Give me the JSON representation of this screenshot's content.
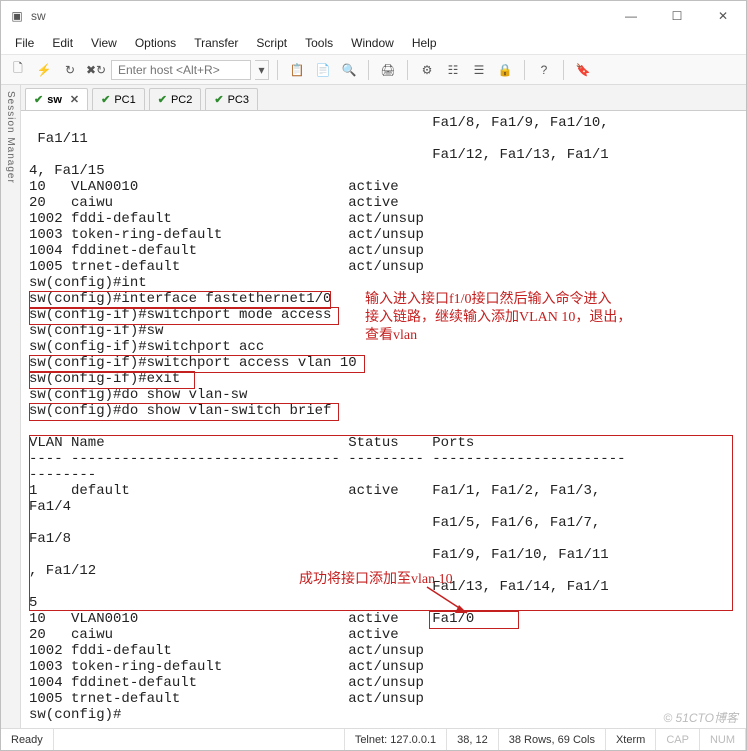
{
  "window": {
    "title": "sw"
  },
  "winbtn": {
    "min": "—",
    "max": "☐",
    "close": "✕"
  },
  "menu": {
    "file": "File",
    "edit": "Edit",
    "view": "View",
    "options": "Options",
    "transfer": "Transfer",
    "script": "Script",
    "tools": "Tools",
    "window": "Window",
    "help": "Help"
  },
  "toolbar": {
    "host_placeholder": "Enter host <Alt+R>"
  },
  "icons": {
    "app": "▣",
    "newdoc": "🗋",
    "bolt": "⚡",
    "reconnect": "↻",
    "disconnect": "✖↻",
    "paste": "📋",
    "copy": "📄",
    "find": "🔍",
    "print": "🖨",
    "cfg": "⚙",
    "opts": "☷",
    "props": "☰",
    "lock": "🔒",
    "help": "?",
    "bookmarks": "🔖"
  },
  "sidebar": {
    "label": "Session Manager"
  },
  "tabs": [
    {
      "label": "sw",
      "active": true,
      "closable": true
    },
    {
      "label": "PC1",
      "active": false,
      "closable": false
    },
    {
      "label": "PC2",
      "active": false,
      "closable": false
    },
    {
      "label": "PC3",
      "active": false,
      "closable": false
    }
  ],
  "terminal": {
    "text": "                                                Fa1/8, Fa1/9, Fa1/10,\n Fa1/11\n                                                Fa1/12, Fa1/13, Fa1/1\n4, Fa1/15\n10   VLAN0010                         active\n20   caiwu                            active\n1002 fddi-default                     act/unsup\n1003 token-ring-default               act/unsup\n1004 fddinet-default                  act/unsup\n1005 trnet-default                    act/unsup\nsw(config)#int\nsw(config)#interface fastethernet1/0\nsw(config-if)#switchport mode access\nsw(config-if)#sw\nsw(config-if)#switchport acc\nsw(config-if)#switchport access vlan 10\nsw(config-if)#exit\nsw(config)#do show vlan-sw\nsw(config)#do show vlan-switch brief\n\nVLAN Name                             Status    Ports\n---- -------------------------------- --------- -----------------------\n--------\n1    default                          active    Fa1/1, Fa1/2, Fa1/3,\nFa1/4\n                                                Fa1/5, Fa1/6, Fa1/7,\nFa1/8\n                                                Fa1/9, Fa1/10, Fa1/11\n, Fa1/12\n                                                Fa1/13, Fa1/14, Fa1/1\n5\n10   VLAN0010                         active    Fa1/0\n20   caiwu                            active\n1002 fddi-default                     act/unsup\n1003 token-ring-default               act/unsup\n1004 fddinet-default                  act/unsup\n1005 trnet-default                    act/unsup\nsw(config)#"
  },
  "annotations": {
    "note1": "输入进入接口f1/0接口然后输入命令进入\n接入链路，继续输入添加VLAN 10，退出，\n查看vlan",
    "note2": "成功将接口添加至vlan 10"
  },
  "status": {
    "ready": "Ready",
    "conn": "Telnet: 127.0.0.1",
    "pos": "38,  12",
    "size": "38 Rows, 69 Cols",
    "term": "Xterm",
    "caps": "CAP",
    "num": "NUM"
  },
  "watermark": "© 51CTO博客"
}
